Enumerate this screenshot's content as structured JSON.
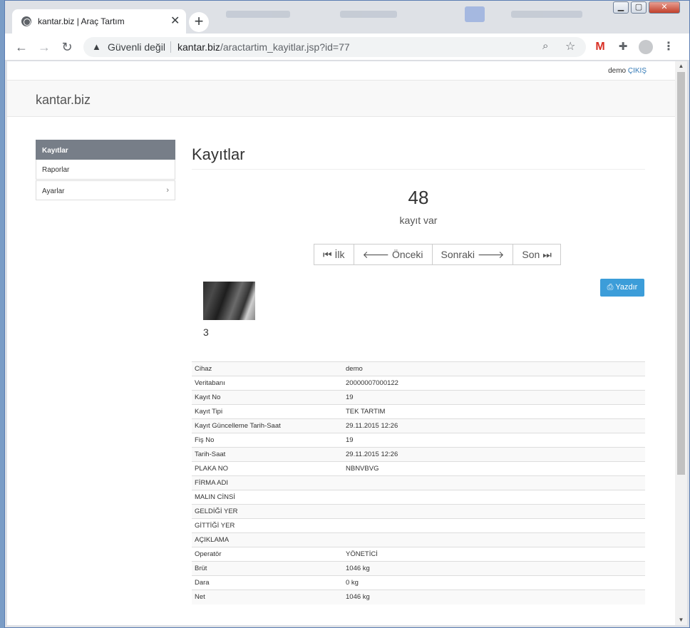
{
  "browser": {
    "tab_title": "kantar.biz | Araç Tartım",
    "close_glyph": "✕",
    "new_tab_glyph": "+",
    "security_label": "Güvenli değil",
    "url_host": "kantar.biz",
    "url_path": "/aractartim_kayitlar.jsp?id=77"
  },
  "page": {
    "user": "demo",
    "logout": "ÇIKIŞ",
    "brand": "kantar.biz",
    "sidebar": [
      {
        "label": "Kayıtlar"
      },
      {
        "label": "Raporlar"
      },
      {
        "label": "Ayarlar"
      }
    ],
    "heading": "Kayıtlar",
    "count": "48",
    "count_label": "kayıt var",
    "pager": {
      "first": "İlk",
      "prev": "Önceki",
      "next": "Sonraki",
      "last": "Son"
    },
    "print": "Yazdır",
    "image_number": "3",
    "details": [
      {
        "k": "Cihaz",
        "v": "demo"
      },
      {
        "k": "Veritabanı",
        "v": "20000007000122"
      },
      {
        "k": "Kayıt No",
        "v": "19"
      },
      {
        "k": "Kayıt Tipi",
        "v": "TEK TARTIM"
      },
      {
        "k": "Kayıt Güncelleme Tarih-Saat",
        "v": "29.11.2015 12:26"
      },
      {
        "k": "Fiş No",
        "v": "19"
      },
      {
        "k": "Tarih-Saat",
        "v": "29.11.2015 12:26"
      },
      {
        "k": "PLAKA NO",
        "v": "NBNVBVG"
      },
      {
        "k": "FİRMA ADI",
        "v": ""
      },
      {
        "k": "MALIN CİNSİ",
        "v": ""
      },
      {
        "k": "GELDİĞİ YER",
        "v": ""
      },
      {
        "k": "GİTTİĞİ YER",
        "v": ""
      },
      {
        "k": "AÇIKLAMA",
        "v": ""
      },
      {
        "k": "Operatör",
        "v": "YÖNETİCİ"
      },
      {
        "k": "Brüt",
        "v": "1046 kg"
      },
      {
        "k": "Dara",
        "v": "0 kg"
      },
      {
        "k": "Net",
        "v": "1046 kg"
      }
    ]
  }
}
